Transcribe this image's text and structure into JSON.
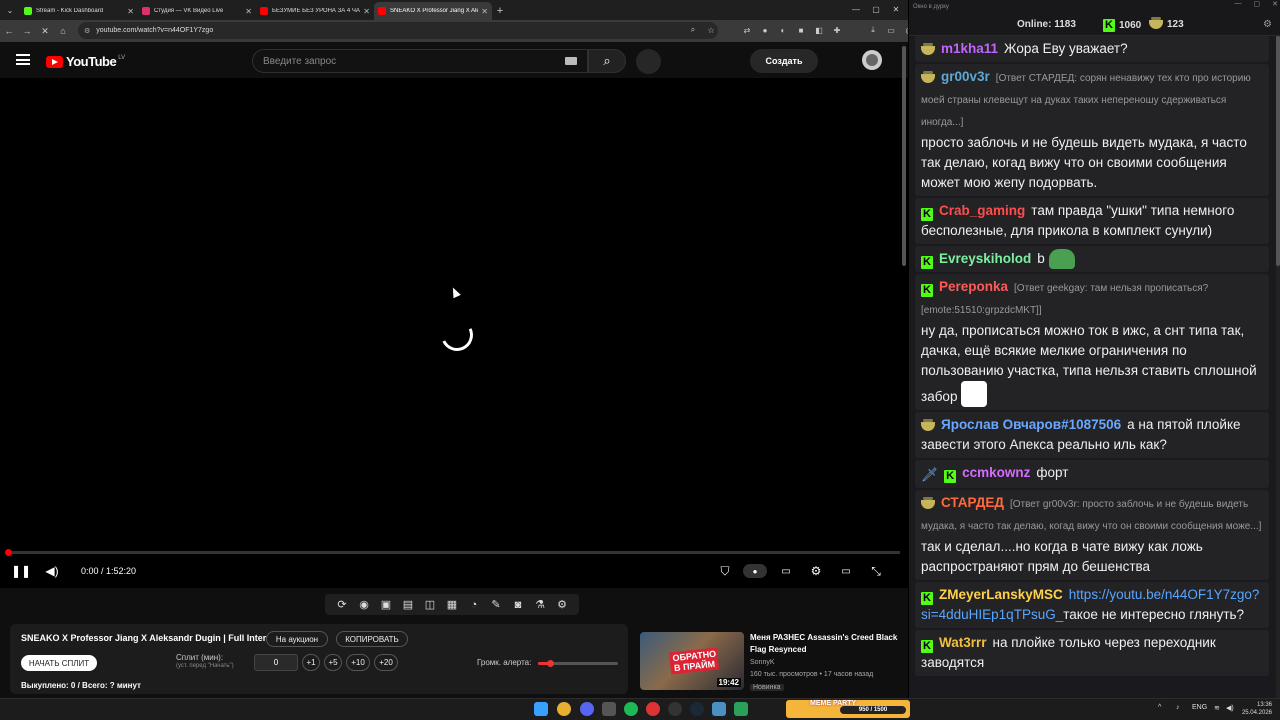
{
  "browser": {
    "tabs": [
      {
        "label": "Stream - Kick Dashboard",
        "color": "#53fc18"
      },
      {
        "label": "Студия — VK Видео Live",
        "color": "#e0306a"
      },
      {
        "label": "БЕЗУМИЕ БЕЗ УРОНА ЗА 4 ЧА",
        "color": "#ff0000"
      },
      {
        "label": "SNEAKO X Professor Jiang X Ale",
        "color": "#ff0000"
      }
    ],
    "url": "youtube.com/watch?v=n44OF1Y7zgo"
  },
  "youtube": {
    "logo": "YouTube",
    "region": "LV",
    "search_placeholder": "Введите запрос",
    "create_label": "Создать",
    "timecode": "0:00 / 1:52:20",
    "progress": 0
  },
  "panel": {
    "title": "SNEAKO X Professor Jiang X Aleksandr Dugin | Full Interview",
    "auction_label": "На аукцион",
    "copy_label": "КОПИРОВАТЬ",
    "start_split_label": "НАЧАТЬ СПЛИТ",
    "split_label": "Сплит (мин):",
    "split_hint": "(уст. перед \"Начать\")",
    "split_value": "0",
    "steps": [
      "+1",
      "+5",
      "+10",
      "+20"
    ],
    "alert_label": "Громк. алерта:",
    "alert_volume": 0.15,
    "bought_text": "Выкуплено: 0 / Всего: ? минут"
  },
  "recommendation": {
    "thumb_text": "ОБРАТНО В ПРАЙМ",
    "duration": "19:42",
    "title": "Меня РАЗНЕС Assassin's Creed Black Flag Resynced",
    "channel": "SonnyK",
    "meta": "160 тыс. просмотров • 17 часов назад",
    "badge": "Новинка"
  },
  "chat": {
    "window_title": "Окно в дурку",
    "online_label": "Online:",
    "online_count": "1183",
    "kick_count": "1060",
    "vk_count": "123",
    "messages": [
      {
        "platform": "vk",
        "nick": "m1kha11",
        "nick_color": "#c264ff",
        "reply": "",
        "text": "Жора Еву уважает?"
      },
      {
        "platform": "vk",
        "nick": "gr00v3r",
        "nick_color": "#5fa8d3",
        "reply": "[Ответ СТАРДЕД: сорян ненавижу тех кто про историю моей страны клевещут на дуках таких непереношу сдерживаться иногда...]",
        "text": "просто заблочь и не будешь видеть мудака, я часто так делаю, когад вижу что он своими сообщения может мою жепу подорвать."
      },
      {
        "platform": "kick",
        "nick": "Crab_gaming",
        "nick_color": "#ff4d4d",
        "reply": "",
        "text": "там правда \"ушки\" типа немного бесполезные, для прикола в комплект сунули)"
      },
      {
        "platform": "kick",
        "nick": "Evreyskiholod",
        "nick_color": "#7cf0a0",
        "reply": "",
        "text": "b"
      },
      {
        "platform": "kick",
        "nick": "Pereponka",
        "nick_color": "#ff5a5a",
        "reply": "[Ответ geekgay: там нельзя прописаться? [emote:51510:grpzdcMKT]]",
        "text": "ну да, прописаться можно ток в ижс, а снт типа так, дачка, ещё всякие мелкие ограничения по пользованию участка, типа нельзя ставить сплошной забор"
      },
      {
        "platform": "vk",
        "nick": "Ярослав Овчаров#1087506",
        "nick_color": "#6aa8ff",
        "reply": "",
        "text": "а на пятой плойке завести этого Апекса реально иль как?"
      },
      {
        "platform": "kick2",
        "nick": "ccmkownz",
        "nick_color": "#d46cff",
        "reply": "",
        "text": "форт"
      },
      {
        "platform": "vk",
        "nick": "СТАРДЕД",
        "nick_color": "#ff6a3d",
        "reply": "[Ответ gr00v3r: просто заблочь и не будешь видеть мудака, я часто так делаю, когад вижу что он своими сообщения може...]",
        "text": "так и сделал....но когда в чате вижу как ложь распространяют прям до бешенства"
      },
      {
        "platform": "kick",
        "nick": "ZMeyerLanskyMSC",
        "nick_color": "#ffd24a",
        "reply": "",
        "link": "https://youtu.be/n44OF1Y7zgo?si=4dduHIEp1qTPsuG_",
        "text": "такое не интересно глянуть?"
      },
      {
        "platform": "kick",
        "nick": "Wat3rrr",
        "nick_color": "#f0c040",
        "reply": "",
        "text": "на плойке только через переходник заводятся"
      }
    ]
  },
  "taskbar": {
    "meme_label": "MEME PARTY",
    "meme_progress": "950 / 1500",
    "lang": "ENG",
    "time": "13:36",
    "date": "25.04.2026"
  }
}
